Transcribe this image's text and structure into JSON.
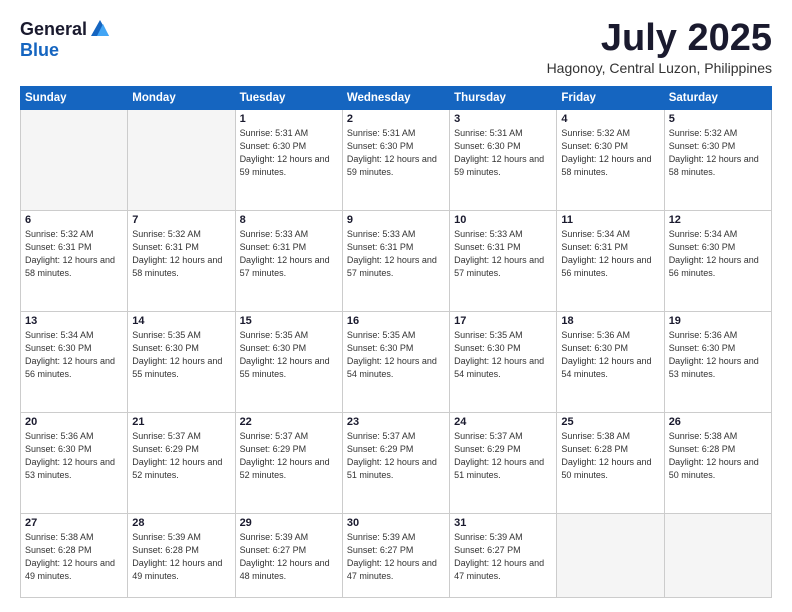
{
  "header": {
    "logo_general": "General",
    "logo_blue": "Blue",
    "month_title": "July 2025",
    "location": "Hagonoy, Central Luzon, Philippines"
  },
  "weekdays": [
    "Sunday",
    "Monday",
    "Tuesday",
    "Wednesday",
    "Thursday",
    "Friday",
    "Saturday"
  ],
  "weeks": [
    [
      {
        "day": "",
        "empty": true
      },
      {
        "day": "",
        "empty": true
      },
      {
        "day": "1",
        "sunrise": "5:31 AM",
        "sunset": "6:30 PM",
        "daylight": "12 hours and 59 minutes."
      },
      {
        "day": "2",
        "sunrise": "5:31 AM",
        "sunset": "6:30 PM",
        "daylight": "12 hours and 59 minutes."
      },
      {
        "day": "3",
        "sunrise": "5:31 AM",
        "sunset": "6:30 PM",
        "daylight": "12 hours and 59 minutes."
      },
      {
        "day": "4",
        "sunrise": "5:32 AM",
        "sunset": "6:30 PM",
        "daylight": "12 hours and 58 minutes."
      },
      {
        "day": "5",
        "sunrise": "5:32 AM",
        "sunset": "6:30 PM",
        "daylight": "12 hours and 58 minutes."
      }
    ],
    [
      {
        "day": "6",
        "sunrise": "5:32 AM",
        "sunset": "6:31 PM",
        "daylight": "12 hours and 58 minutes."
      },
      {
        "day": "7",
        "sunrise": "5:32 AM",
        "sunset": "6:31 PM",
        "daylight": "12 hours and 58 minutes."
      },
      {
        "day": "8",
        "sunrise": "5:33 AM",
        "sunset": "6:31 PM",
        "daylight": "12 hours and 57 minutes."
      },
      {
        "day": "9",
        "sunrise": "5:33 AM",
        "sunset": "6:31 PM",
        "daylight": "12 hours and 57 minutes."
      },
      {
        "day": "10",
        "sunrise": "5:33 AM",
        "sunset": "6:31 PM",
        "daylight": "12 hours and 57 minutes."
      },
      {
        "day": "11",
        "sunrise": "5:34 AM",
        "sunset": "6:31 PM",
        "daylight": "12 hours and 56 minutes."
      },
      {
        "day": "12",
        "sunrise": "5:34 AM",
        "sunset": "6:30 PM",
        "daylight": "12 hours and 56 minutes."
      }
    ],
    [
      {
        "day": "13",
        "sunrise": "5:34 AM",
        "sunset": "6:30 PM",
        "daylight": "12 hours and 56 minutes."
      },
      {
        "day": "14",
        "sunrise": "5:35 AM",
        "sunset": "6:30 PM",
        "daylight": "12 hours and 55 minutes."
      },
      {
        "day": "15",
        "sunrise": "5:35 AM",
        "sunset": "6:30 PM",
        "daylight": "12 hours and 55 minutes."
      },
      {
        "day": "16",
        "sunrise": "5:35 AM",
        "sunset": "6:30 PM",
        "daylight": "12 hours and 54 minutes."
      },
      {
        "day": "17",
        "sunrise": "5:35 AM",
        "sunset": "6:30 PM",
        "daylight": "12 hours and 54 minutes."
      },
      {
        "day": "18",
        "sunrise": "5:36 AM",
        "sunset": "6:30 PM",
        "daylight": "12 hours and 54 minutes."
      },
      {
        "day": "19",
        "sunrise": "5:36 AM",
        "sunset": "6:30 PM",
        "daylight": "12 hours and 53 minutes."
      }
    ],
    [
      {
        "day": "20",
        "sunrise": "5:36 AM",
        "sunset": "6:30 PM",
        "daylight": "12 hours and 53 minutes."
      },
      {
        "day": "21",
        "sunrise": "5:37 AM",
        "sunset": "6:29 PM",
        "daylight": "12 hours and 52 minutes."
      },
      {
        "day": "22",
        "sunrise": "5:37 AM",
        "sunset": "6:29 PM",
        "daylight": "12 hours and 52 minutes."
      },
      {
        "day": "23",
        "sunrise": "5:37 AM",
        "sunset": "6:29 PM",
        "daylight": "12 hours and 51 minutes."
      },
      {
        "day": "24",
        "sunrise": "5:37 AM",
        "sunset": "6:29 PM",
        "daylight": "12 hours and 51 minutes."
      },
      {
        "day": "25",
        "sunrise": "5:38 AM",
        "sunset": "6:28 PM",
        "daylight": "12 hours and 50 minutes."
      },
      {
        "day": "26",
        "sunrise": "5:38 AM",
        "sunset": "6:28 PM",
        "daylight": "12 hours and 50 minutes."
      }
    ],
    [
      {
        "day": "27",
        "sunrise": "5:38 AM",
        "sunset": "6:28 PM",
        "daylight": "12 hours and 49 minutes."
      },
      {
        "day": "28",
        "sunrise": "5:39 AM",
        "sunset": "6:28 PM",
        "daylight": "12 hours and 49 minutes."
      },
      {
        "day": "29",
        "sunrise": "5:39 AM",
        "sunset": "6:27 PM",
        "daylight": "12 hours and 48 minutes."
      },
      {
        "day": "30",
        "sunrise": "5:39 AM",
        "sunset": "6:27 PM",
        "daylight": "12 hours and 47 minutes."
      },
      {
        "day": "31",
        "sunrise": "5:39 AM",
        "sunset": "6:27 PM",
        "daylight": "12 hours and 47 minutes."
      },
      {
        "day": "",
        "empty": true
      },
      {
        "day": "",
        "empty": true
      }
    ]
  ]
}
